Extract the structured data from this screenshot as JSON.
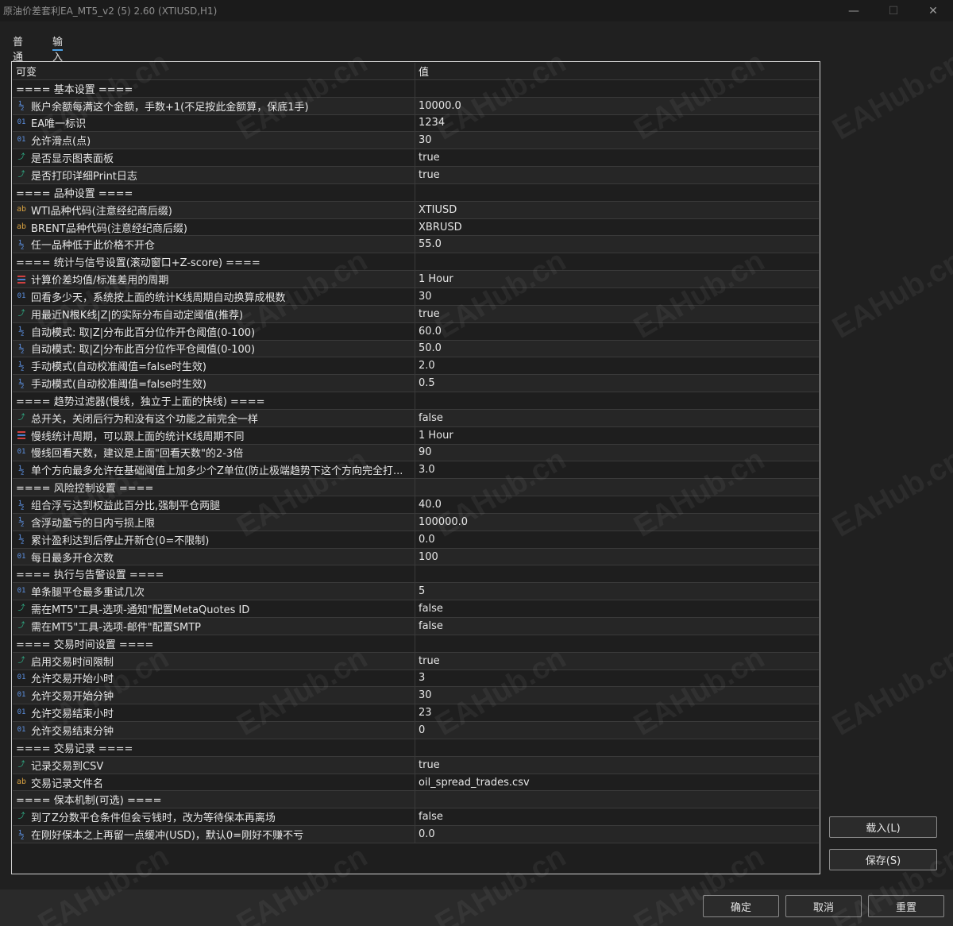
{
  "window": {
    "title": "原油价差套利EA_MT5_v2 (5) 2.60 (XTIUSD,H1)",
    "minimize": "—",
    "maximize": "☐",
    "close": "✕"
  },
  "tabs": [
    "普通",
    "输入"
  ],
  "active_tab": "输入",
  "table": {
    "headers": [
      "可变",
      "值"
    ],
    "rows": [
      {
        "type": "section",
        "name": "==== 基本设置 ====",
        "value": ""
      },
      {
        "type": "double",
        "name": "账户余额每满这个金额，手数+1(不足按此金额算，保底1手)",
        "value": "10000.0"
      },
      {
        "type": "int",
        "name": "EA唯一标识",
        "value": "1234"
      },
      {
        "type": "int",
        "name": "允许滑点(点)",
        "value": "30"
      },
      {
        "type": "bool",
        "name": "是否显示图表面板",
        "value": "true"
      },
      {
        "type": "bool",
        "name": "是否打印详细Print日志",
        "value": "true"
      },
      {
        "type": "section",
        "name": "==== 品种设置 ====",
        "value": ""
      },
      {
        "type": "string",
        "name": "WTI品种代码(注意经纪商后缀)",
        "value": "XTIUSD"
      },
      {
        "type": "string",
        "name": "BRENT品种代码(注意经纪商后缀)",
        "value": "XBRUSD"
      },
      {
        "type": "double",
        "name": "任一品种低于此价格不开仓",
        "value": "55.0"
      },
      {
        "type": "section",
        "name": "==== 统计与信号设置(滚动窗口+Z-score) ====",
        "value": ""
      },
      {
        "type": "enum",
        "name": "计算价差均值/标准差用的周期",
        "value": "1 Hour"
      },
      {
        "type": "int",
        "name": "回看多少天，系统按上面的统计K线周期自动换算成根数",
        "value": "30"
      },
      {
        "type": "bool",
        "name": "用最近N根K线|Z|的实际分布自动定阈值(推荐)",
        "value": "true"
      },
      {
        "type": "double",
        "name": "自动模式: 取|Z|分布此百分位作开仓阈值(0-100)",
        "value": "60.0"
      },
      {
        "type": "double",
        "name": "自动模式: 取|Z|分布此百分位作平仓阈值(0-100)",
        "value": "50.0"
      },
      {
        "type": "double",
        "name": "手动模式(自动校准阈值=false时生效)",
        "value": "2.0"
      },
      {
        "type": "double",
        "name": "手动模式(自动校准阈值=false时生效)",
        "value": "0.5"
      },
      {
        "type": "section",
        "name": "==== 趋势过滤器(慢线，独立于上面的快线) ====",
        "value": ""
      },
      {
        "type": "bool",
        "name": "总开关，关闭后行为和没有这个功能之前完全一样",
        "value": "false"
      },
      {
        "type": "enum",
        "name": "慢线统计周期，可以跟上面的统计K线周期不同",
        "value": "1 Hour"
      },
      {
        "type": "int",
        "name": "慢线回看天数，建议是上面\"回看天数\"的2-3倍",
        "value": "90"
      },
      {
        "type": "double",
        "name": "单个方向最多允许在基础阈值上加多少个Z单位(防止极端趋势下这个方向完全打...",
        "value": "3.0"
      },
      {
        "type": "section",
        "name": "==== 风险控制设置 ====",
        "value": ""
      },
      {
        "type": "double",
        "name": "组合浮亏达到权益此百分比,强制平仓两腿",
        "value": "40.0"
      },
      {
        "type": "double",
        "name": "含浮动盈亏的日内亏损上限",
        "value": "100000.0"
      },
      {
        "type": "double",
        "name": "累计盈利达到后停止开新仓(0=不限制)",
        "value": "0.0"
      },
      {
        "type": "int",
        "name": "每日最多开仓次数",
        "value": "100"
      },
      {
        "type": "section",
        "name": "==== 执行与告警设置 ====",
        "value": ""
      },
      {
        "type": "int",
        "name": "单条腿平仓最多重试几次",
        "value": "5"
      },
      {
        "type": "bool",
        "name": "需在MT5\"工具-选项-通知\"配置MetaQuotes ID",
        "value": "false"
      },
      {
        "type": "bool",
        "name": "需在MT5\"工具-选项-邮件\"配置SMTP",
        "value": "false"
      },
      {
        "type": "section",
        "name": "==== 交易时间设置 ====",
        "value": ""
      },
      {
        "type": "bool",
        "name": "启用交易时间限制",
        "value": "true"
      },
      {
        "type": "int",
        "name": "允许交易开始小时",
        "value": "3"
      },
      {
        "type": "int",
        "name": "允许交易开始分钟",
        "value": "30"
      },
      {
        "type": "int",
        "name": "允许交易结束小时",
        "value": "23"
      },
      {
        "type": "int",
        "name": "允许交易结束分钟",
        "value": "0"
      },
      {
        "type": "section",
        "name": "==== 交易记录 ====",
        "value": ""
      },
      {
        "type": "bool",
        "name": "记录交易到CSV",
        "value": "true"
      },
      {
        "type": "string",
        "name": "交易记录文件名",
        "value": "oil_spread_trades.csv"
      },
      {
        "type": "section",
        "name": "==== 保本机制(可选) ====",
        "value": ""
      },
      {
        "type": "bool",
        "name": "到了Z分数平仓条件但会亏钱时，改为等待保本再离场",
        "value": "false"
      },
      {
        "type": "double",
        "name": "在刚好保本之上再留一点缓冲(USD)，默认0=刚好不赚不亏",
        "value": "0.0"
      }
    ]
  },
  "icons": {
    "double": {
      "glyph": "½",
      "name": "fraction-icon",
      "color": "#5b8fe0"
    },
    "int": {
      "glyph": "01",
      "name": "integer-icon",
      "color": "#5b8fe0"
    },
    "bool": {
      "glyph": "⤴",
      "name": "boolean-arrow-icon",
      "color": "#2fb38a"
    },
    "string": {
      "glyph": "ab",
      "name": "string-icon",
      "color": "#d6a040"
    },
    "enum": {
      "glyph": "",
      "name": "enum-list-icon",
      "color": "#d04040"
    }
  },
  "side_buttons": {
    "load": "载入(L)",
    "save": "保存(S)"
  },
  "bottom_buttons": {
    "ok": "确定",
    "cancel": "取消",
    "reset": "重置"
  },
  "watermark": "EAHub.cn"
}
